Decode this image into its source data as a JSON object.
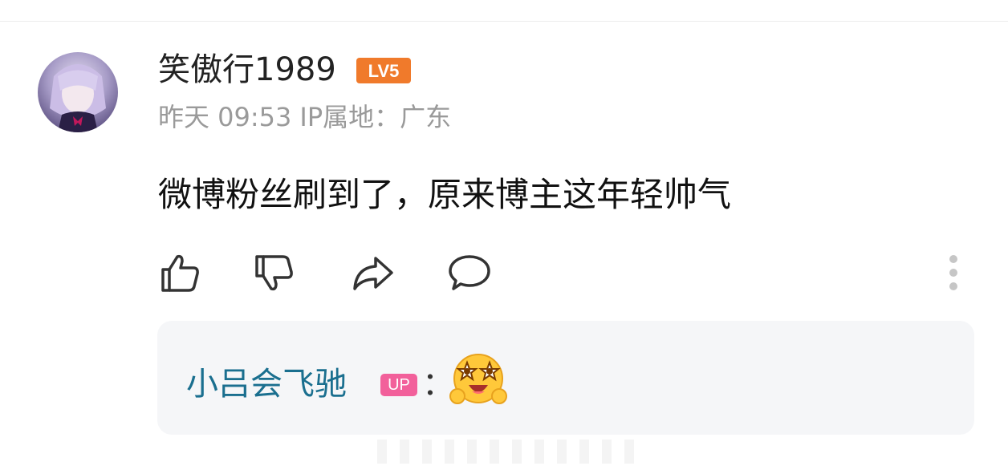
{
  "comment": {
    "username": "笑傲行1989",
    "level_badge": "LV5",
    "time": "昨天 09:53",
    "ip_location": "IP属地：广东",
    "text": "微博粉丝刷到了，原来博主这年轻帅气"
  },
  "actions": [
    {
      "name": "like",
      "icon": "thumbs-up-icon"
    },
    {
      "name": "dislike",
      "icon": "thumbs-down-icon"
    },
    {
      "name": "share",
      "icon": "share-arrow-icon"
    },
    {
      "name": "reply",
      "icon": "comment-bubble-icon"
    }
  ],
  "reply": {
    "author": "小吕会飞驰",
    "author_badge": "UP",
    "colon": "：",
    "emoji": "starstruck-emoji-icon"
  },
  "colors": {
    "reply_author": "#1a6f8f",
    "level_badge": "#f07a2b",
    "up_badge": "#f2609b",
    "reply_bg": "#f5f6f8"
  }
}
